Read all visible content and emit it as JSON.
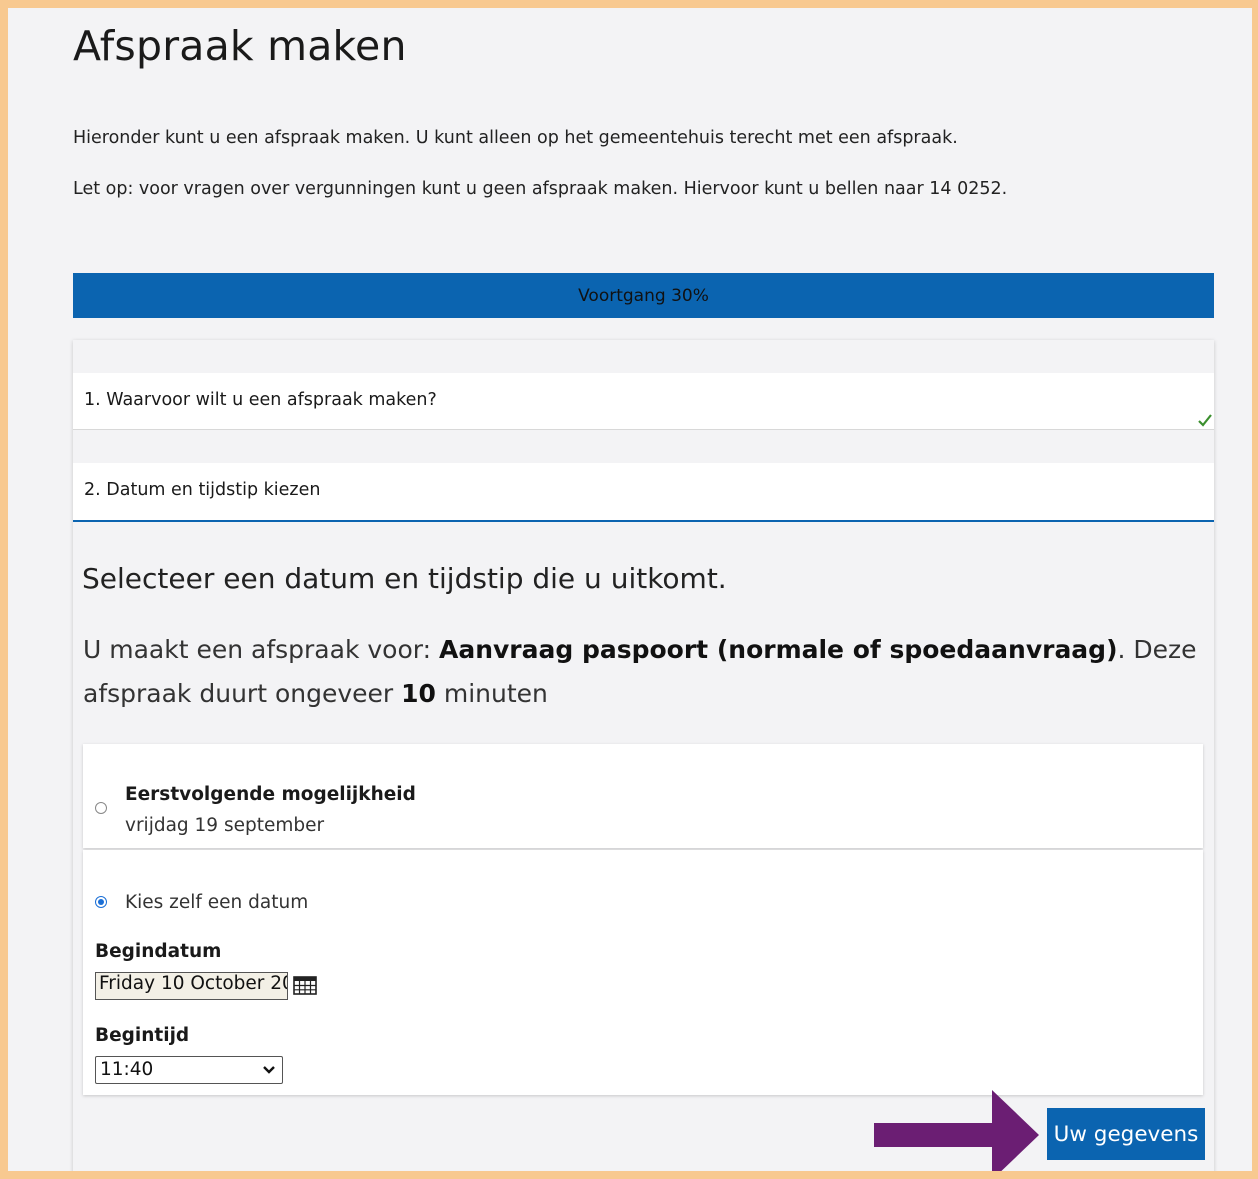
{
  "page": {
    "title": "Afspraak maken",
    "intro_1": "Hieronder kunt u een afspraak maken. U kunt alleen op het gemeentehuis terecht met een afspraak.",
    "intro_2": "Let op: voor vragen over vergunningen kunt u geen afspraak maken. Hiervoor kunt u bellen naar 14 0252."
  },
  "progress": {
    "label": "Voortgang 30%",
    "percent": 30
  },
  "steps": [
    {
      "label": "1. Waarvoor wilt u een afspraak maken?",
      "completed": true,
      "icon": "check-icon"
    },
    {
      "label": "2. Datum en tijdstip kiezen",
      "completed": false
    }
  ],
  "step2": {
    "heading": "Selecteer een datum en tijdstip die u uitkomt.",
    "info_prefix": "U maakt een afspraak voor: ",
    "info_product": "Aanvraag paspoort (normale of spoedaanvraag)",
    "info_middle": ". Deze afspraak duurt ongeveer ",
    "info_minutes": "10",
    "info_suffix": " minuten",
    "option_next": {
      "title": "Eerstvolgende mogelijkheid",
      "subtitle": "vrijdag 19 september",
      "selected": false
    },
    "option_choose": {
      "label": "Kies zelf een datum",
      "selected": true,
      "date_label": "Begindatum",
      "date_value": "Friday 10 October 20",
      "time_label": "Begintijd",
      "time_value": "11:40"
    }
  },
  "actions": {
    "next_label": "Uw gegevens"
  },
  "colors": {
    "accent": "#0b64b0",
    "frame": "#f8c990",
    "arrow": "#6b1e73",
    "check": "#3b8f2e"
  }
}
